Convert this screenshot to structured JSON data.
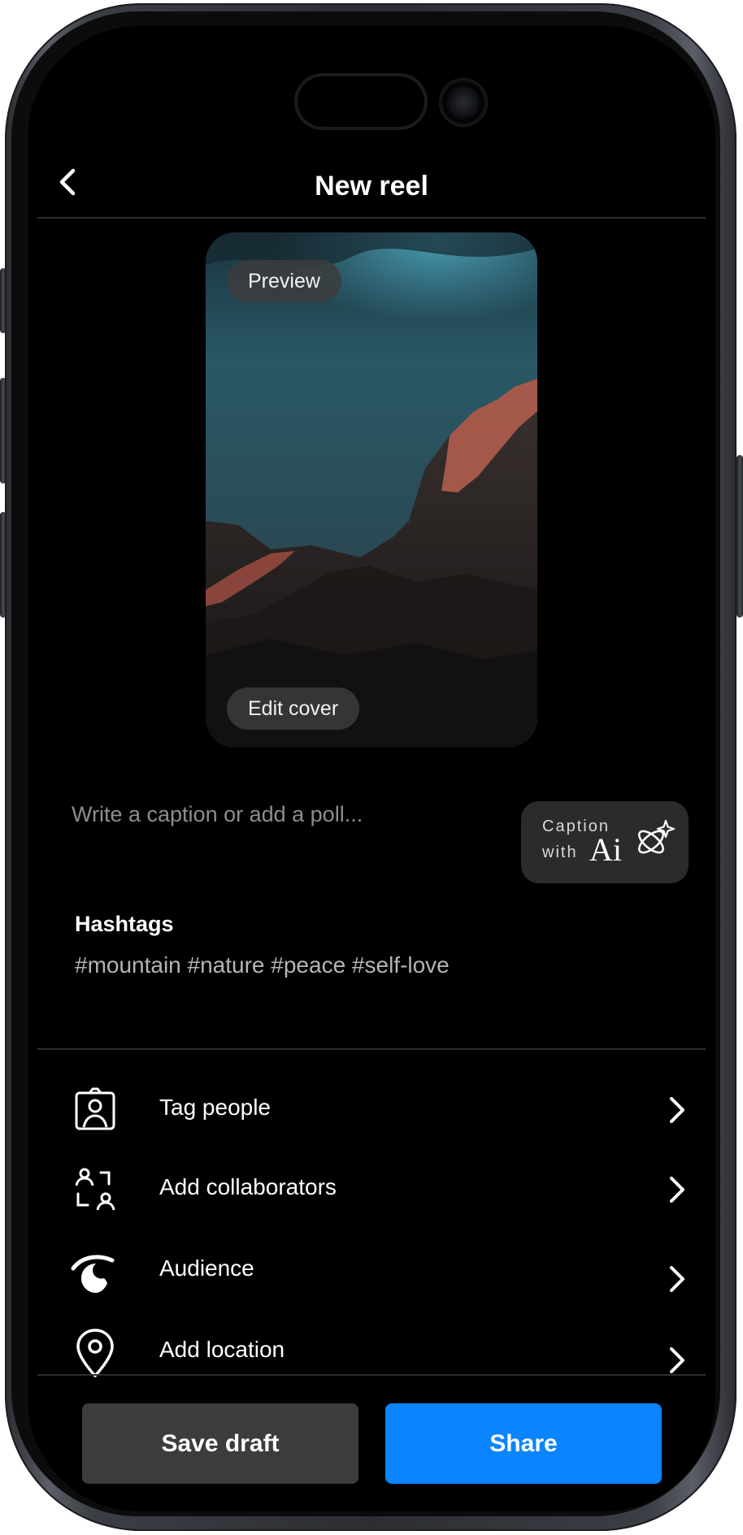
{
  "header": {
    "title": "New reel"
  },
  "preview": {
    "preview_label": "Preview",
    "edit_cover_label": "Edit cover"
  },
  "caption": {
    "placeholder": "Write a caption or add a poll...",
    "ai_button": {
      "line1": "Caption",
      "line2": "with",
      "ai": "Ai"
    }
  },
  "hashtags": {
    "label": "Hashtags",
    "value": "#mountain #nature #peace #self-love"
  },
  "menu": {
    "items": [
      {
        "label": "Tag people",
        "icon": "tag-person-icon"
      },
      {
        "label": "Add collaborators",
        "icon": "collaborators-icon"
      },
      {
        "label": "Audience",
        "icon": "audience-icon"
      },
      {
        "label": "Add location",
        "icon": "location-pin-icon"
      }
    ]
  },
  "actions": {
    "save_draft": "Save draft",
    "share": "Share"
  },
  "colors": {
    "accent": "#0a84ff",
    "background": "#000000",
    "secondary_button": "#3c3c3e"
  }
}
